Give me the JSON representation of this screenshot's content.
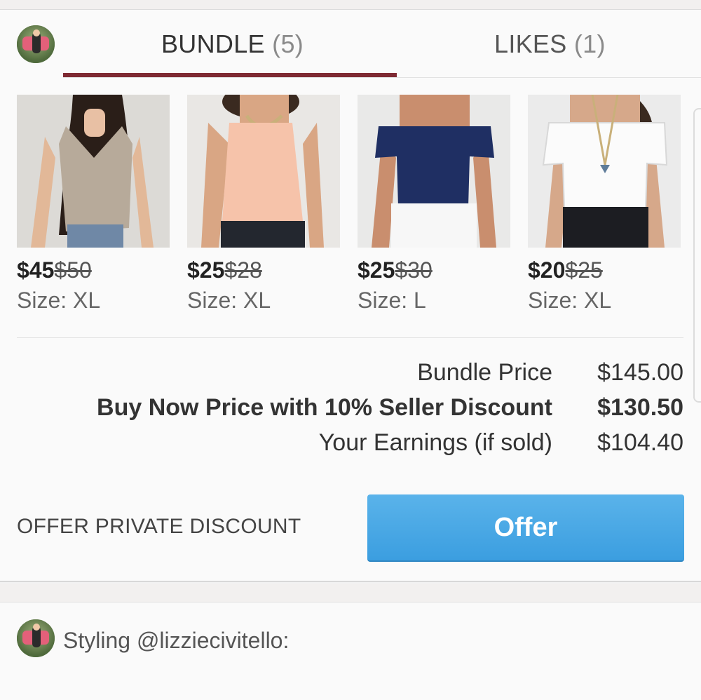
{
  "tabs": {
    "bundle": {
      "label": "BUNDLE",
      "count": "(5)"
    },
    "likes": {
      "label": "LIKES",
      "count": "(1)"
    }
  },
  "items": [
    {
      "price": "$45",
      "original_price": "$50",
      "size": "Size: XL"
    },
    {
      "price": "$25",
      "original_price": "$28",
      "size": "Size: XL"
    },
    {
      "price": "$25",
      "original_price": "$30",
      "size": "Size: L"
    },
    {
      "price": "$20",
      "original_price": "$25",
      "size": "Size: XL"
    }
  ],
  "summary": {
    "bundle_price_label": "Bundle Price",
    "bundle_price_value": "$145.00",
    "buy_now_label": "Buy Now Price with 10% Seller Discount",
    "buy_now_value": "$130.50",
    "earnings_label": "Your Earnings (if sold)",
    "earnings_value": "$104.40"
  },
  "offer": {
    "private_discount_label": "OFFER PRIVATE DISCOUNT",
    "button_label": "Offer"
  },
  "comment": {
    "text": "Styling @lizziecivitello:"
  },
  "colors": {
    "tab_underline": "#7f2a33",
    "offer_button": "#3b9ee0"
  },
  "icons": {
    "avatar": "user-avatar"
  }
}
